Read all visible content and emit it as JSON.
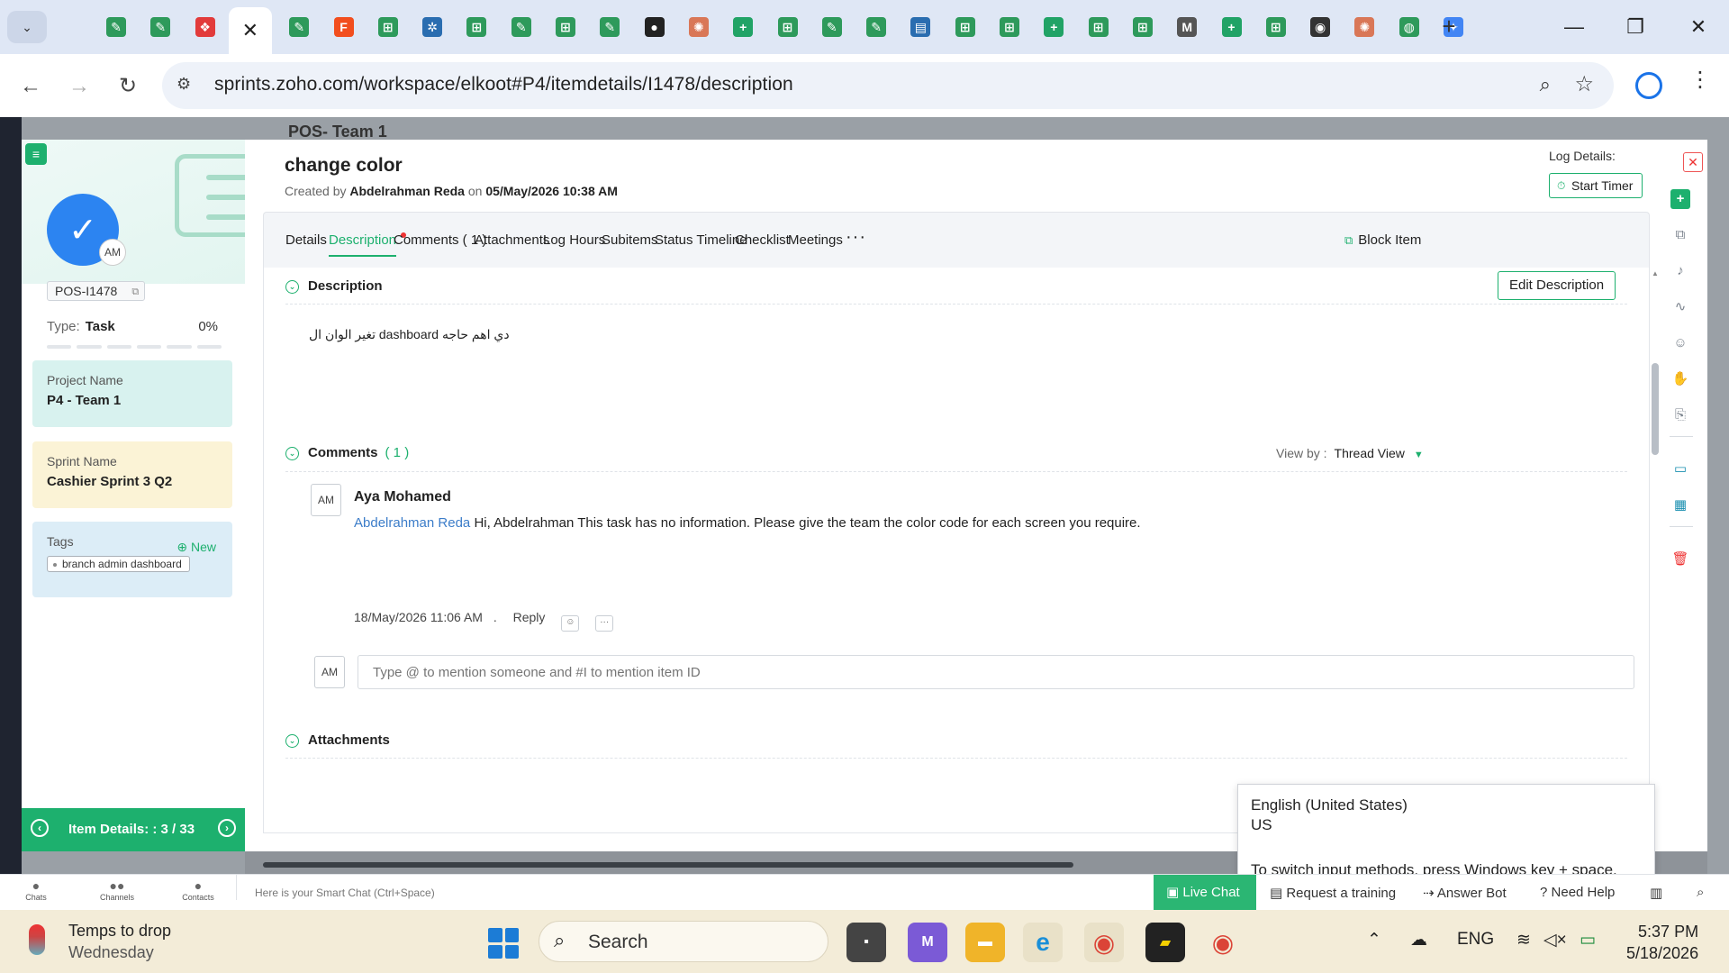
{
  "browser": {
    "active_tab_close": "✕",
    "url": "sprints.zoho.com/workspace/elkoot#P4/itemdetails/I1478/description",
    "tab_icons": [
      {
        "icon": "zoho-sprints-icon",
        "color": "#2e9a5b",
        "glyph": "✎"
      },
      {
        "icon": "zoho-sprints-icon",
        "color": "#2e9a5b",
        "glyph": "✎"
      },
      {
        "icon": "zoho-cliq-icon",
        "color": "#e23b3b",
        "glyph": "❖"
      },
      {
        "icon": "zoho-sprints-icon",
        "color": "#2e9a5b",
        "glyph": "✎"
      },
      {
        "icon": "figma-icon",
        "color": "#f24e1e",
        "glyph": "F"
      },
      {
        "icon": "sheet-add-icon",
        "color": "#2e9a5b",
        "glyph": "⊞"
      },
      {
        "icon": "settings-icon",
        "color": "#2a6db0",
        "glyph": "✲"
      },
      {
        "icon": "sheet-add-icon",
        "color": "#2e9a5b",
        "glyph": "⊞"
      },
      {
        "icon": "zoho-sprints-icon",
        "color": "#2e9a5b",
        "glyph": "✎"
      },
      {
        "icon": "sheet-add-icon",
        "color": "#2e9a5b",
        "glyph": "⊞"
      },
      {
        "icon": "zoho-sprints-icon",
        "color": "#2e9a5b",
        "glyph": "✎"
      },
      {
        "icon": "cloud-icon",
        "color": "#222222",
        "glyph": "●"
      },
      {
        "icon": "claude-icon",
        "color": "#d97757",
        "glyph": "✺"
      },
      {
        "icon": "plus-sheet-icon",
        "color": "#21a366",
        "glyph": "+"
      },
      {
        "icon": "sheet-add-icon",
        "color": "#2e9a5b",
        "glyph": "⊞"
      },
      {
        "icon": "zoho-sprints-icon",
        "color": "#2e9a5b",
        "glyph": "✎"
      },
      {
        "icon": "zoho-sprints-icon",
        "color": "#2e9a5b",
        "glyph": "✎"
      },
      {
        "icon": "analytics-icon",
        "color": "#2a6db0",
        "glyph": "▤"
      },
      {
        "icon": "sheet-add-icon",
        "color": "#2e9a5b",
        "glyph": "⊞"
      },
      {
        "icon": "sheet-add-icon",
        "color": "#2e9a5b",
        "glyph": "⊞"
      },
      {
        "icon": "plus-sheet-icon",
        "color": "#21a366",
        "glyph": "+"
      },
      {
        "icon": "sheet-add-icon",
        "color": "#2e9a5b",
        "glyph": "⊞"
      },
      {
        "icon": "sheet-add-icon",
        "color": "#2e9a5b",
        "glyph": "⊞"
      },
      {
        "icon": "gmail-icon",
        "color": "#555555",
        "glyph": "M"
      },
      {
        "icon": "plus-sheet-icon",
        "color": "#21a366",
        "glyph": "+"
      },
      {
        "icon": "sheet-add-icon",
        "color": "#2e9a5b",
        "glyph": "⊞"
      },
      {
        "icon": "github-icon",
        "color": "#333333",
        "glyph": "◉"
      },
      {
        "icon": "claude-icon",
        "color": "#d97757",
        "glyph": "✺"
      },
      {
        "icon": "chatgpt-icon",
        "color": "#2e9a5b",
        "glyph": "◍"
      },
      {
        "icon": "gemini-icon",
        "color": "#4285f4",
        "glyph": "✦"
      }
    ]
  },
  "page_bg": {
    "title": "POS- Team 1"
  },
  "summary": {
    "menu_glyph": "≡",
    "avatar_initials": "AM",
    "item_id": "POS-I1478",
    "type_label": "Type:",
    "type_value": "Task",
    "progress": "0%",
    "project_label": "Project Name",
    "project_value": "P4 - Team 1",
    "sprint_label": "Sprint Name",
    "sprint_value": "Cashier Sprint 3 Q2",
    "tags_label": "Tags",
    "tags_new": "New",
    "tag_chip": "branch admin dashboard",
    "footer": "Item Details: : 3 / 33"
  },
  "item": {
    "title": "change color",
    "created_prefix": "Created by",
    "created_by": "Abdelrahman Reda",
    "created_on_word": "on",
    "created_at": "05/May/2026 10:38 AM",
    "log_details": "Log Details:",
    "start_timer": "Start Timer"
  },
  "tabs": [
    {
      "label": "Details"
    },
    {
      "label": "Description"
    },
    {
      "label": "Comments ( 1 )"
    },
    {
      "label": "Attachments"
    },
    {
      "label": "Log Hours"
    },
    {
      "label": "Subitems"
    },
    {
      "label": "Status Timeline"
    },
    {
      "label": "Checklist"
    },
    {
      "label": "Meetings"
    }
  ],
  "tabs_more": "···",
  "block_item": "Block Item",
  "description": {
    "heading": "Description",
    "edit_button": "Edit Description",
    "text": "دي اهم حاجه dashboard تغير الوان ال"
  },
  "comments": {
    "heading": "Comments",
    "count": "( 1 )",
    "view_by_label": "View by :",
    "view_by_value": "Thread View",
    "items": [
      {
        "initials": "AM",
        "author": "Aya Mohamed",
        "mention": "Abdelrahman Reda",
        "text": "Hi, Abdelrahman This task has no information. Please give the team the color code for each screen you require.",
        "time": "18/May/2026 11:06 AM",
        "dot": ".",
        "reply": "Reply",
        "more": "···"
      }
    ],
    "input_initials": "AM",
    "input_placeholder": "Type @ to mention someone and #I to mention item ID"
  },
  "attachments": {
    "heading": "Attachments"
  },
  "ime_popup": {
    "language": "English (United States)",
    "layout": "US",
    "hint": "To switch input methods, press Windows key + space."
  },
  "zoho_bar": {
    "chats": "Chats",
    "channels": "Channels",
    "contacts": "Contacts",
    "smart_chat": "Here is your Smart Chat (Ctrl+Space)",
    "live_chat": "Live Chat",
    "request_training": "Request a training",
    "answer_bot": "Answer Bot",
    "need_help": "Need Help"
  },
  "taskbar": {
    "weather_title": "Temps to drop",
    "weather_day": "Wednesday",
    "search": "Search",
    "language": "ENG",
    "time": "5:37 PM",
    "date": "5/18/2026"
  }
}
